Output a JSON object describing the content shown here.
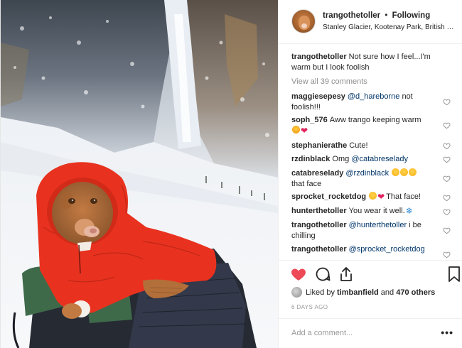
{
  "post": {
    "author": "trangothetoller",
    "separator": "•",
    "follow_state": "Following",
    "location": "Stanley Glacier, Kootenay Park, British Col...",
    "caption": {
      "username": "trangothetoller",
      "text": "Not sure how I feel...I'm warm but I look foolish"
    },
    "view_all": "View all 39 comments",
    "comments": [
      {
        "username": "maggiesepesy",
        "mention": "@d_hareborne",
        "text": " not foolish!!!"
      },
      {
        "username": "soph_576",
        "text": "Aww trango keeping warm",
        "emojis": [
          "star-struck-emoji",
          "red-heart-emoji"
        ]
      },
      {
        "username": "stephanierathe",
        "text": "Cute!"
      },
      {
        "username": "rzdinblack",
        "text": "Omg ",
        "mention": "@catabreselady"
      },
      {
        "username": "catabreselady",
        "mention": "@rzdinblack",
        "text": " that face",
        "emojis": [
          "laughing-emoji",
          "laughing-emoji",
          "laughing-emoji"
        ]
      },
      {
        "username": "sprocket_rocketdog",
        "text": "That face!",
        "emojis": [
          "laughing-emoji",
          "red-heart-emoji"
        ]
      },
      {
        "username": "hunterthetoller",
        "text": "You wear it well.",
        "emojis": [
          "snowflake-emoji"
        ]
      },
      {
        "username": "trangothetoller",
        "mention": "@hunterthetoller",
        "text": " i be chilling"
      },
      {
        "username": "trangothetoller",
        "mention": "@sprocket_rocketdog"
      }
    ],
    "likes": {
      "prefix": "Liked by",
      "user": "timbanfield",
      "conjunction": "and",
      "others": "470 others"
    },
    "timestamp": "6 DAYS AGO",
    "add_comment_placeholder": "Add a comment...",
    "more_label": "•••",
    "colors": {
      "like_red": "#ed4956",
      "mention_blue": "#003569",
      "jacket_red": "#e8321f",
      "muted_text": "#8e8e8e"
    },
    "icons": [
      "heart-icon",
      "comment-icon",
      "share-icon",
      "bookmark-icon",
      "heart-outline-icon"
    ]
  }
}
